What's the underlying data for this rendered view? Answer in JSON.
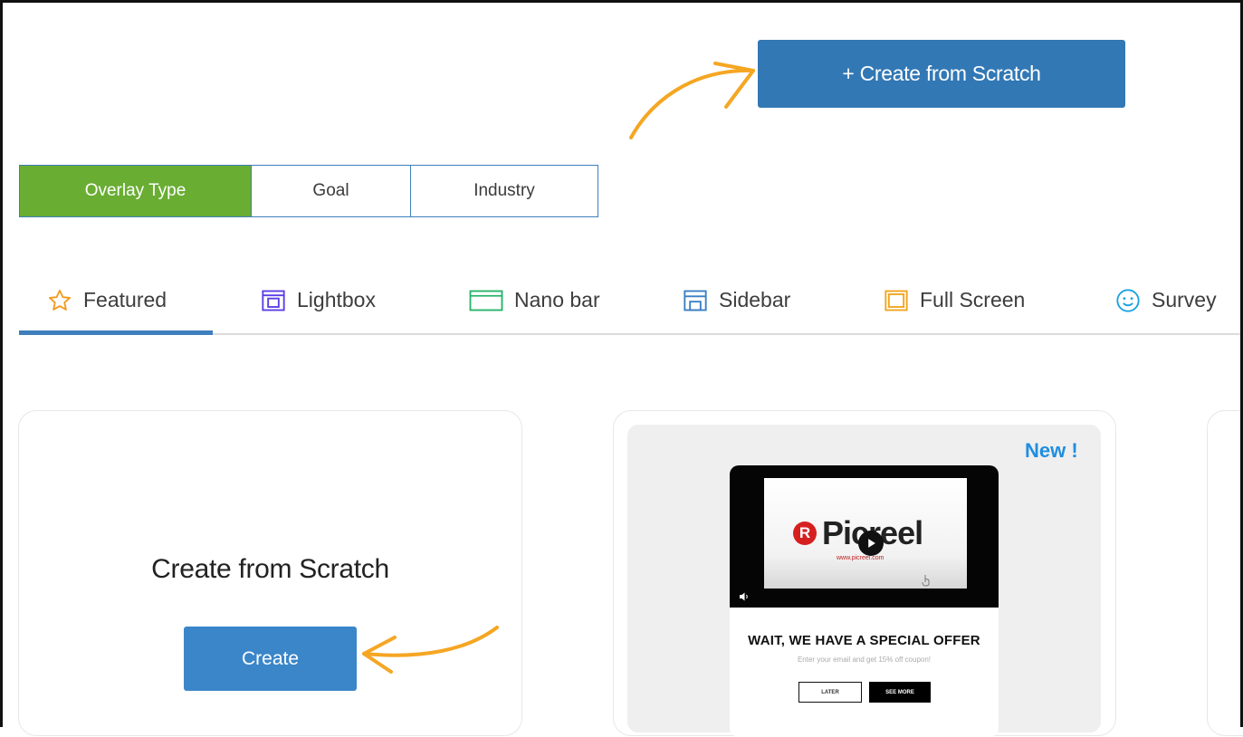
{
  "header": {
    "create_button_label": "+ Create from Scratch"
  },
  "filter": {
    "segments": [
      {
        "label": "Overlay Type",
        "active": true
      },
      {
        "label": "Goal",
        "active": false
      },
      {
        "label": "Industry",
        "active": false
      }
    ]
  },
  "tabs": [
    {
      "label": "Featured",
      "icon": "star-icon",
      "color": "#f29a1e",
      "active": true
    },
    {
      "label": "Lightbox",
      "icon": "lightbox-icon",
      "color": "#5b3ee6"
    },
    {
      "label": "Nano bar",
      "icon": "nanobar-icon",
      "color": "#27b36a"
    },
    {
      "label": "Sidebar",
      "icon": "sidebar-icon",
      "color": "#3a7fc4"
    },
    {
      "label": "Full Screen",
      "icon": "fullscreen-icon",
      "color": "#f2a51e"
    },
    {
      "label": "Survey",
      "icon": "smiley-icon",
      "color": "#1aa3e0"
    }
  ],
  "scratch_card": {
    "title": "Create from Scratch",
    "button_label": "Create"
  },
  "template_card": {
    "badge": "New !",
    "preview": {
      "logo_letter": "R",
      "logo_text": "Picreel",
      "logo_url": "www.picreel.com",
      "headline": "WAIT, WE HAVE A SPECIAL OFFER",
      "subtext": "Enter your email and get 15% off coupon!",
      "later_label": "LATER",
      "see_more_label": "SEE MORE"
    }
  },
  "colors": {
    "primary": "#3278b5",
    "active_green": "#69ad33",
    "accent_orange": "#f5a623",
    "badge_blue": "#1f8ee0"
  }
}
